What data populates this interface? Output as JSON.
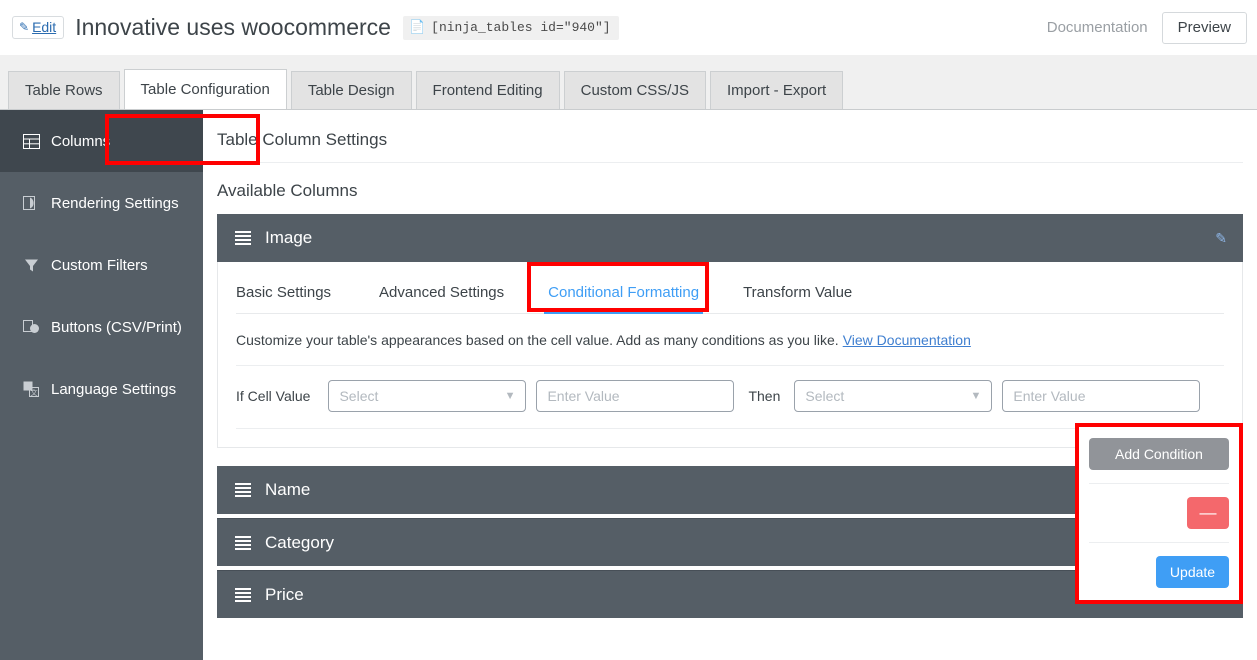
{
  "topbar": {
    "edit_label": "Edit",
    "edit_icon": "pencil-icon",
    "title": "Innovative uses woocommerce",
    "shortcode_icon": "document-icon",
    "shortcode": "[ninja_tables id=\"940\"]",
    "documentation_label": "Documentation",
    "preview_label": "Preview"
  },
  "tabs": [
    {
      "label": "Table Rows",
      "active": false
    },
    {
      "label": "Table Configuration",
      "active": true
    },
    {
      "label": "Table Design",
      "active": false
    },
    {
      "label": "Frontend Editing",
      "active": false
    },
    {
      "label": "Custom CSS/JS",
      "active": false
    },
    {
      "label": "Import - Export",
      "active": false
    }
  ],
  "sidebar": {
    "items": [
      {
        "label": "Columns",
        "icon": "table-columns-icon",
        "active": true
      },
      {
        "label": "Rendering Settings",
        "icon": "rendering-icon",
        "active": false
      },
      {
        "label": "Custom Filters",
        "icon": "filter-icon",
        "active": false
      },
      {
        "label": "Buttons (CSV/Print)",
        "icon": "buttons-copy-icon",
        "active": false
      },
      {
        "label": "Language Settings",
        "icon": "language-translate-icon",
        "active": false
      }
    ]
  },
  "main": {
    "section_title": "Table Column Settings",
    "sub_title": "Available Columns",
    "columns": [
      {
        "name": "Image",
        "expanded": true
      },
      {
        "name": "Name",
        "expanded": false
      },
      {
        "name": "Category",
        "expanded": false
      },
      {
        "name": "Price",
        "expanded": false
      }
    ],
    "inner_tabs": [
      {
        "label": "Basic Settings",
        "active": false
      },
      {
        "label": "Advanced Settings",
        "active": false
      },
      {
        "label": "Conditional Formatting",
        "active": true
      },
      {
        "label": "Transform Value",
        "active": false
      }
    ],
    "description": "Customize your table's appearances based on the cell value. Add as many conditions as you like.",
    "description_link": "View Documentation",
    "condition_row": {
      "if_label": "If Cell Value",
      "operator_placeholder": "Select",
      "operator_value": "",
      "value_placeholder": "Enter Value",
      "value_value": "",
      "then_label": "Then",
      "action_placeholder": "Select",
      "action_value": "",
      "action_value_placeholder": "Enter Value",
      "action_value_value": "",
      "remove_label": "—"
    },
    "actions": {
      "add_condition_label": "Add Condition",
      "remove_label": "—",
      "update_label": "Update"
    }
  },
  "colors": {
    "sidebar_bg": "#555e66",
    "sidebar_active_bg": "#3f474e",
    "accent_blue": "#3f9ef5",
    "danger_red": "#f4686c",
    "annotation_red": "#ff0000",
    "panel_header_bg": "#555e66"
  }
}
